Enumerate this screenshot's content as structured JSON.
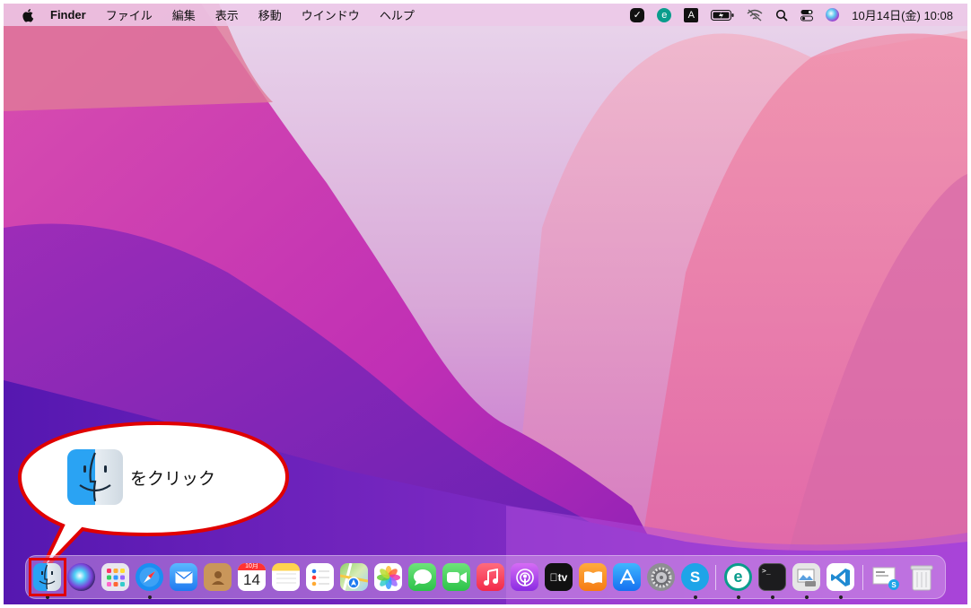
{
  "menubar": {
    "app_name": "Finder",
    "menus": [
      "ファイル",
      "編集",
      "表示",
      "移動",
      "ウインドウ",
      "ヘルプ"
    ],
    "clock": "10月14日(金) 10:08",
    "status_icons": [
      "checkmark-icon",
      "eset-icon",
      "input-method-icon",
      "battery-icon",
      "wifi-off-icon",
      "search-icon",
      "control-center-icon",
      "siri-icon"
    ],
    "input_method_label": "A"
  },
  "callout": {
    "text": "をクリック",
    "highlight_color": "#e00000"
  },
  "dock": {
    "apps": [
      {
        "name": "finder-icon",
        "running": true
      },
      {
        "name": "siri-icon",
        "running": false
      },
      {
        "name": "launchpad-icon",
        "running": false
      },
      {
        "name": "safari-icon",
        "running": true
      },
      {
        "name": "mail-icon",
        "running": false
      },
      {
        "name": "contacts-icon",
        "running": false
      },
      {
        "name": "calendar-icon",
        "running": false,
        "month": "10月",
        "day": "14"
      },
      {
        "name": "notes-icon",
        "running": false
      },
      {
        "name": "reminders-icon",
        "running": false
      },
      {
        "name": "maps-icon",
        "running": false
      },
      {
        "name": "photos-icon",
        "running": false
      },
      {
        "name": "messages-icon",
        "running": false
      },
      {
        "name": "facetime-icon",
        "running": false
      },
      {
        "name": "music-icon",
        "running": false
      },
      {
        "name": "podcasts-icon",
        "running": false
      },
      {
        "name": "apple-tv-icon",
        "running": false,
        "label": "tv"
      },
      {
        "name": "books-icon",
        "running": false
      },
      {
        "name": "app-store-icon",
        "running": false
      },
      {
        "name": "system-preferences-icon",
        "running": false
      },
      {
        "name": "skype-icon",
        "running": true,
        "label": "S"
      },
      {
        "name": "eset-icon",
        "running": true,
        "label": "e"
      },
      {
        "name": "terminal-icon",
        "running": true,
        "label": ">_"
      },
      {
        "name": "preview-icon",
        "running": true
      },
      {
        "name": "vscode-icon",
        "running": true
      },
      {
        "name": "downloads-stack-icon",
        "running": false
      },
      {
        "name": "trash-icon",
        "running": false
      }
    ]
  }
}
